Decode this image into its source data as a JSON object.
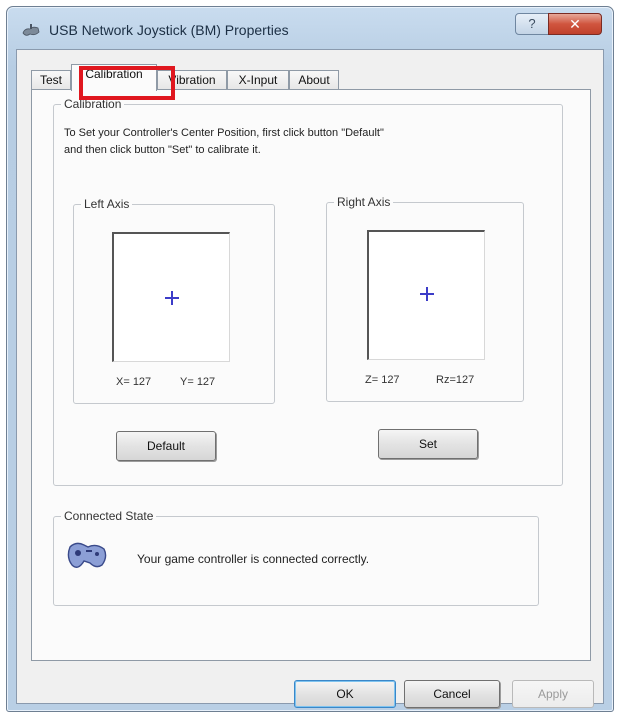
{
  "window": {
    "title": "USB Network Joystick (BM) Properties",
    "help_label": "?",
    "close_label": "✕"
  },
  "tabs": [
    {
      "label": "Test",
      "active": false
    },
    {
      "label": "Calibration",
      "active": true
    },
    {
      "label": "Vibration",
      "active": false
    },
    {
      "label": "X-Input",
      "active": false
    },
    {
      "label": "About",
      "active": false
    }
  ],
  "calibration": {
    "group_label": "Calibration",
    "instruction_line1": "To Set your Controller's  Center Position, first click button \"Default\"",
    "instruction_line2": "and then click button \"Set\" to calibrate it.",
    "left_axis": {
      "label": "Left Axis",
      "x_text": "X= 127",
      "y_text": "Y= 127"
    },
    "right_axis": {
      "label": "Right Axis",
      "z_text": "Z= 127",
      "rz_text": "Rz=127"
    },
    "default_button": "Default",
    "set_button": "Set"
  },
  "connected_state": {
    "group_label": "Connected State",
    "message": "Your game controller is connected correctly."
  },
  "footer": {
    "ok_label": "OK",
    "cancel_label": "Cancel",
    "apply_label": "Apply"
  },
  "colors": {
    "highlight": "#e0171f",
    "crosshair": "#3c3cc8"
  },
  "icons": {
    "title": "joystick-icon",
    "status": "gamepad-icon"
  }
}
